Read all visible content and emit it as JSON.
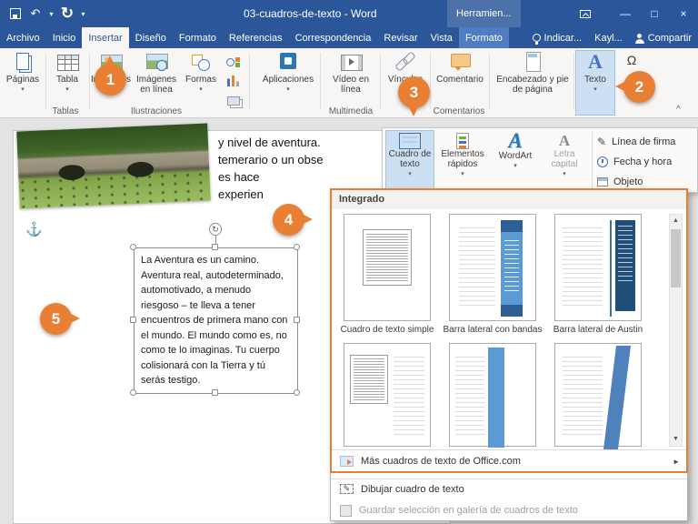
{
  "titlebar": {
    "title": "03-cuadros-de-texto - Word",
    "contextual_group": "Herramien..."
  },
  "icons": {
    "caret_down": "▾",
    "caret_up": "^",
    "undo": "↶",
    "redo": "↻",
    "minimize": "—",
    "maximize": "□",
    "close": "×",
    "anchor": "⚓",
    "rotate": "↻",
    "scroll_up": "▲",
    "scroll_down": "▼",
    "submenu_arrow": "►",
    "omega": "Ω",
    "pi": "π",
    "pencil": "✎",
    "letter_a": "A"
  },
  "tabs": {
    "items": [
      "Archivo",
      "Inicio",
      "Insertar",
      "Diseño",
      "Formato",
      "Referencias",
      "Correspondencia",
      "Revisar",
      "Vista"
    ],
    "contextual": "Formato",
    "tell_me": "Indicar...",
    "user": "Kayl...",
    "share": "Compartir"
  },
  "ribbon": {
    "paginas": "Páginas",
    "tabla": "Tabla",
    "imagenes": "Imágenes",
    "imagenes_en_linea": "Imágenes en línea",
    "formas": "Formas",
    "aplicaciones": "Aplicaciones",
    "video_en_linea": "Vídeo en línea",
    "vinculos": "Vínculos",
    "comentario": "Comentario",
    "encabezado": "Encabezado y pie de página",
    "texto": "Texto",
    "group_labels": [
      "Tablas",
      "Ilustraciones",
      "Multimedia",
      "Comentarios"
    ]
  },
  "texto_menu": {
    "cuadro_de_texto": "Cuadro de texto",
    "elementos_rapidos": "Elementos rápidos",
    "wordart": "WordArt",
    "letra_capital": "Letra capital",
    "linea_de_firma": "Línea de firma",
    "fecha_y_hora": "Fecha y hora",
    "objeto": "Objeto"
  },
  "gallery": {
    "header": "Integrado",
    "items": [
      "Cuadro de texto simple",
      "Barra lateral con bandas",
      "Barra lateral de Austin"
    ],
    "more_link": "Más cuadros de texto de Office.com",
    "draw": "Dibujar cuadro de texto",
    "save_selection": "Guardar selección en galería de cuadros de texto"
  },
  "document": {
    "paragraph_lines": [
      "y nivel de aventura.",
      "temerario o un obse",
      "es hace",
      "experien"
    ],
    "textbox_text": "La Aventura es un camino. Aventura real, autodeterminado, automotivado, a menudo riesgoso – te lleva a tener encuentros de primera mano con el mundo. El mundo como es, no como te lo imaginas. Tu cuerpo colisionará con la Tierra y tú serás testigo."
  },
  "callouts": [
    "1",
    "2",
    "3",
    "4",
    "5"
  ],
  "colors": {
    "word_blue": "#2b579a",
    "callout_orange": "#e87f33",
    "highlight_border": "#e87f33"
  }
}
